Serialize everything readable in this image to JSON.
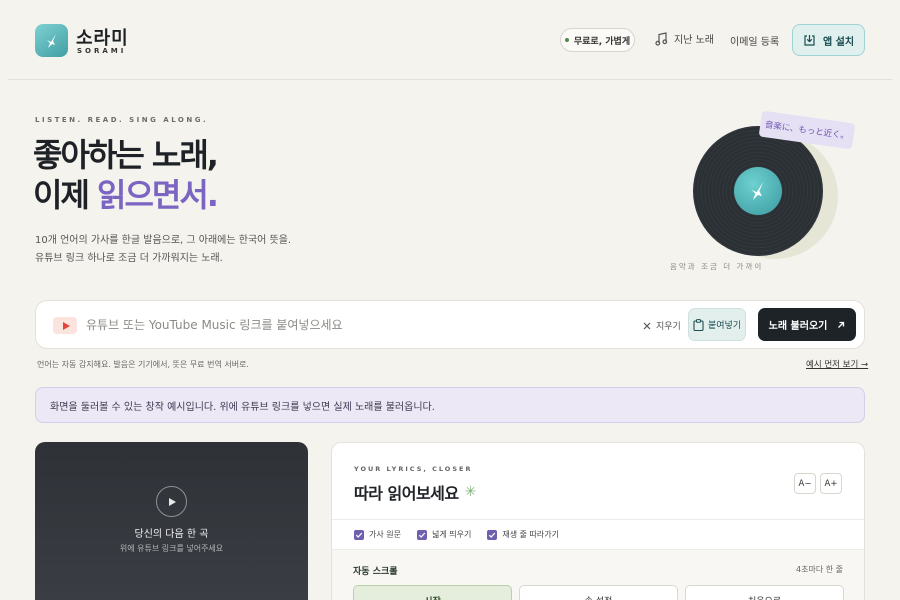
{
  "header": {
    "logo_name": "소라미",
    "logo_sub": "SORAMI",
    "free_pill": "무료로, 가볍게",
    "nav_past": "지난 노래",
    "nav_email": "이메일 등록",
    "install_label": "앱 설치"
  },
  "hero": {
    "eyebrow": "LISTEN. READ. SING ALONG.",
    "title_line1": "좋아하는 노래,",
    "title_line2_prefix": "이제 ",
    "title_line2_accent": "읽으면서.",
    "desc_line1": "10개 언어의 가사를 한글 발음으로, 그 아래에는 한국어 뜻을.",
    "desc_line2": "유튜브 링크 하나로 조금 더 가까워지는 노래.",
    "vinyl_tag": "音楽に、もっと近く。",
    "vinyl_caption": "음악과 조금 더 가까이"
  },
  "search": {
    "placeholder": "유튜브 또는 YouTube Music 링크를 붙여넣으세요",
    "value": "",
    "clear_label": "지우기",
    "paste_label": "붙여넣기",
    "load_label": "노래 불러오기",
    "hint": "언어는 자동 감지해요. 발음은 기기에서, 뜻은 무료 번역 서버로.",
    "example_link": "예시 먼저 보기 →"
  },
  "notice": "화면을 둘러볼 수 있는 창작 예시입니다. 위에 유튜브 링크를 넣으면 실제 노래를 불러옵니다.",
  "player": {
    "title": "당신의 다음 한 곡",
    "subtitle": "위에 유튜브 링크를 넣어주세요"
  },
  "lyrics": {
    "eyebrow": "YOUR LYRICS, CLOSER",
    "title": "따라 읽어보세요",
    "font_decrease": "A−",
    "font_increase": "A+",
    "options": [
      {
        "label": "가사 원문",
        "checked": true
      },
      {
        "label": "넓게 띄우기",
        "checked": true
      },
      {
        "label": "재생 줄 따라가기",
        "checked": true
      }
    ],
    "scroll_label": "자동 스크롤",
    "scroll_rate": "4초마다 한 줄",
    "scroll_buttons": [
      "시작",
      "속 설정",
      "처음으로"
    ]
  },
  "colors": {
    "accent_purple": "#7c65c2",
    "brand_teal": "#4aa9ad",
    "dark_button": "#1e2328"
  }
}
